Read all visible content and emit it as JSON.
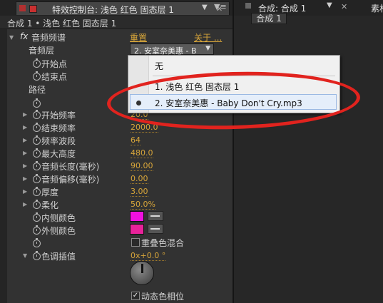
{
  "tabs": {
    "effect_controls": "特效控制台: 浅色 红色 固态层 1",
    "composition": "合成: 合成 1",
    "right_partial": "素材",
    "comp_subtab": "合成 1"
  },
  "breadcrumb": "合成 1 • 浅色 红色 固态层 1",
  "effect": {
    "fx_label": "fx",
    "name": "音频频谱",
    "reset": "重置",
    "about": "关于 ...",
    "audio_layer_label": "音频层",
    "audio_layer_value": "2. 安室奈美惠 - B"
  },
  "properties": [
    {
      "label": "开始点",
      "value": ""
    },
    {
      "label": "结束点",
      "value": ""
    },
    {
      "label": "路径",
      "value": ""
    },
    {
      "label": "",
      "value": ""
    },
    {
      "label": "开始频率",
      "value": "20.0"
    },
    {
      "label": "结束频率",
      "value": "2000.0"
    },
    {
      "label": "频率波段",
      "value": "64"
    },
    {
      "label": "最大高度",
      "value": "480.0"
    },
    {
      "label": "音频长度(毫秒)",
      "value": "90.00"
    },
    {
      "label": "音频偏移(毫秒)",
      "value": "0.00"
    },
    {
      "label": "厚度",
      "value": "3.00"
    },
    {
      "label": "柔化",
      "value": "50.0%"
    },
    {
      "label": "内侧颜色",
      "value": ""
    },
    {
      "label": "外侧颜色",
      "value": ""
    },
    {
      "label": "",
      "value": ""
    },
    {
      "label": "色调插值",
      "value": "0x+0.0 °"
    }
  ],
  "checkboxes": {
    "blend_label": "重叠色混合",
    "dynamic_hue_label": "动态色相位"
  },
  "colors": {
    "inside": "#f010e0",
    "outside": "#e8229a",
    "accent": "#d7a53a",
    "highlight": "#e1231e"
  },
  "popup": {
    "none": "无",
    "item1": "1. 浅色 红色 固态层 1",
    "item2": "2. 安室奈美惠 - Baby Don't Cry.mp3"
  }
}
